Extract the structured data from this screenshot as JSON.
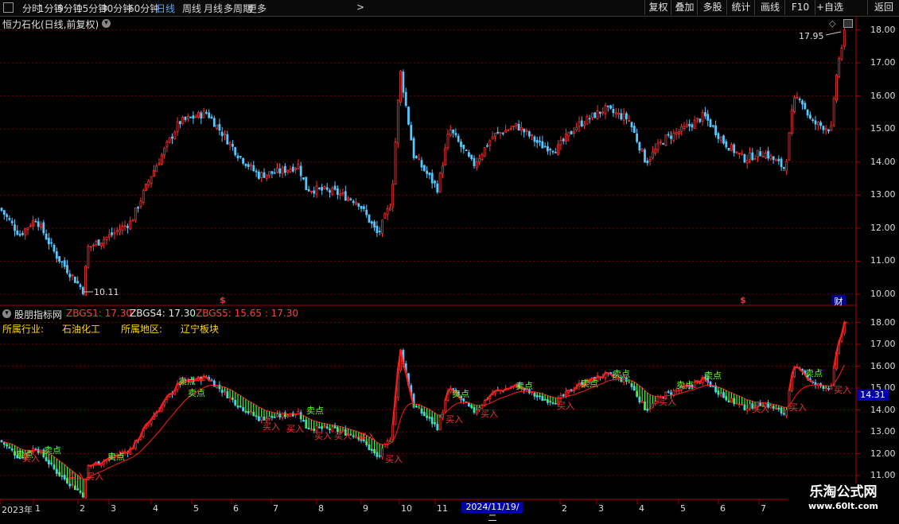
{
  "toolbar": {
    "periods": [
      "分时",
      "1分钟",
      "5分钟",
      "15分钟",
      "30分钟",
      "60分钟",
      "日线",
      "周线",
      "月线",
      "多周期",
      "更多"
    ],
    "active_period": "日线",
    "more_arrow": ">",
    "buttons": [
      "复权",
      "叠加",
      "多股",
      "统计",
      "画线",
      "F10",
      "+自选",
      "返回"
    ],
    "toggle_icon": "panel-toggle-icon"
  },
  "main_panel": {
    "title": "恒力石化(日线,前复权)",
    "dropdown_icon": "chevron-down-icon",
    "y_labels": [
      "18.00",
      "17.00",
      "16.00",
      "15.00",
      "14.00",
      "13.00",
      "12.00",
      "11.00",
      "10.00"
    ],
    "high_annotation": "17.95",
    "low_annotation": "10.11",
    "markers": [
      "$",
      "$",
      "财"
    ]
  },
  "indicator_panel": {
    "name": "股朋指标网",
    "zbgs1": "ZBGS1: 17.30",
    "zbgs4": "ZBGS4: 17.30",
    "zbgs5": "ZBGS5: 15.65 : 17.30",
    "industry_label": "所属行业:",
    "industry_value": "石油化工",
    "region_label": "所属地区:",
    "region_value": "辽宁板块",
    "y_labels": [
      "18.00",
      "17.00",
      "16.00",
      "15.00",
      "14.00",
      "13.00",
      "12.00",
      "11.00"
    ],
    "current_price": "14.31",
    "buy_text": "买入",
    "sell_text": "卖点"
  },
  "x_axis": {
    "labels": [
      "2023年",
      "1",
      "2",
      "3",
      "4",
      "5",
      "6",
      "7",
      "8",
      "9",
      "10",
      "11",
      "1",
      "2",
      "3",
      "4",
      "5",
      "6",
      "7"
    ],
    "cursor_date": "2024/11/19/二"
  },
  "watermark": {
    "line1": "乐淘公式网",
    "line2": "www.60lt.com"
  },
  "colors": {
    "up": "#ff3232",
    "down": "#54c8ff",
    "buy_line": "#ff1a1a",
    "sell_band": "#33ff33",
    "grid": "#8b0000",
    "active_tab": "#4da6ff"
  }
}
